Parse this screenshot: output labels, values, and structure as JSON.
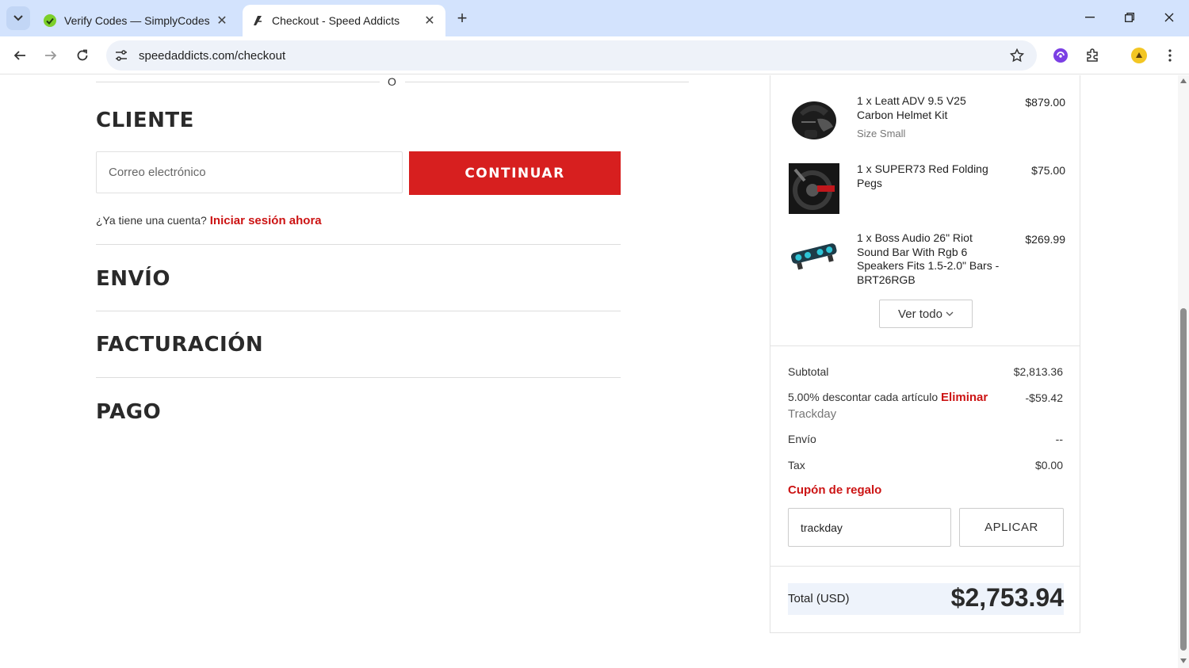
{
  "browser": {
    "tabs": [
      {
        "title": "Verify Codes — SimplyCodes",
        "active": false
      },
      {
        "title": "Checkout - Speed Addicts",
        "active": true
      }
    ],
    "url": "speedaddicts.com/checkout"
  },
  "checkout": {
    "or_text": "O",
    "customer_title": "CLIENTE",
    "email_placeholder": "Correo electrónico",
    "continue_label": "CONTINUAR",
    "account_prompt": "¿Ya tiene una cuenta?",
    "login_link": "Iniciar sesión ahora",
    "shipping_title": "ENVÍO",
    "billing_title": "FACTURACIÓN",
    "payment_title": "PAGO"
  },
  "summary": {
    "items": [
      {
        "name": "1 x Leatt ADV 9.5 V25 Carbon Helmet Kit",
        "meta": "Size Small",
        "price": "$879.00",
        "icon": "helmet-image"
      },
      {
        "name": "1 x SUPER73 Red Folding Pegs",
        "meta": "",
        "price": "$75.00",
        "icon": "pegs-image"
      },
      {
        "name": "1 x Boss Audio 26\" Riot Sound Bar With Rgb 6 Speakers Fits 1.5-2.0\" Bars - BRT26RGB",
        "meta": "",
        "price": "$269.99",
        "icon": "soundbar-image"
      }
    ],
    "see_all_label": "Ver todo",
    "subtotal_label": "Subtotal",
    "subtotal_value": "$2,813.36",
    "discount_label": "5.00% descontar cada artículo",
    "discount_remove": "Eliminar",
    "discount_code": "Trackday",
    "discount_value": "-$59.42",
    "shipping_label": "Envío",
    "shipping_value": "--",
    "tax_label": "Tax",
    "tax_value": "$0.00",
    "gift_title": "Cupón de regalo",
    "coupon_value": "trackday",
    "apply_label": "APLICAR",
    "total_label": "Total (USD)",
    "total_value": "$2,753.94"
  },
  "colors": {
    "brand_red": "#d71f1f",
    "link_red": "#cc1414",
    "tabbar_bg": "#d3e3fd"
  }
}
